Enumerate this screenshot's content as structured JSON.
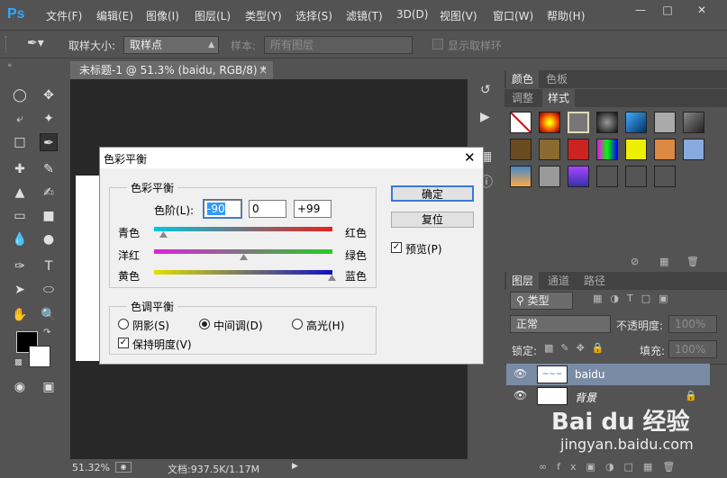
{
  "app": {
    "logo": "Ps"
  },
  "menu": [
    "文件(F)",
    "编辑(E)",
    "图像(I)",
    "图层(L)",
    "类型(Y)",
    "选择(S)",
    "滤镜(T)",
    "3D(D)",
    "视图(V)",
    "窗口(W)",
    "帮助(H)"
  ],
  "options": {
    "sample_size_label": "取样大小:",
    "sample_size_value": "取样点",
    "sample_label": "样本:",
    "sample_value": "所有图层",
    "show_ring_label": "显示取样环"
  },
  "document": {
    "tab_title": "未标题-1 @ 51.3% (baidu, RGB/8) *",
    "zoom": "51.32%",
    "doc_info": "文档:937.5K/1.17M"
  },
  "panels": {
    "top_tabs": [
      "颜色",
      "色板"
    ],
    "mid_tabs": [
      "调整",
      "样式"
    ],
    "layer_tabs": [
      "图层",
      "通道",
      "路径"
    ],
    "filter_kind": "类型",
    "blend_mode": "正常",
    "opacity_label": "不透明度:",
    "opacity_value": "100%",
    "lock_label": "锁定:",
    "fill_label": "填充:",
    "fill_value": "100%",
    "layers": [
      {
        "name": "baidu"
      },
      {
        "name": "背景"
      }
    ]
  },
  "dialog": {
    "title": "色彩平衡",
    "color_balance_group": "色彩平衡",
    "levels_label": "色阶(L):",
    "levels": [
      "-90",
      "0",
      "+99"
    ],
    "sliders": [
      {
        "left": "青色",
        "right": "红色",
        "value": -90
      },
      {
        "left": "洋红",
        "right": "绿色",
        "value": 0
      },
      {
        "left": "黄色",
        "right": "蓝色",
        "value": 99
      }
    ],
    "tone_group": "色调平衡",
    "tones": [
      "阴影(S)",
      "中间调(D)",
      "高光(H)"
    ],
    "selected_tone": "中间调(D)",
    "preserve_luminosity": "保持明度(V)",
    "ok": "确定",
    "reset": "复位",
    "preview": "预览(P)"
  },
  "watermark": {
    "brand": "Bai du 经验",
    "url": "jingyan.baidu.com"
  }
}
